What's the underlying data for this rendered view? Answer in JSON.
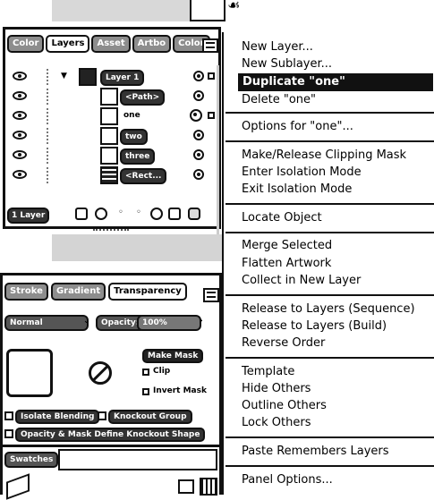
{
  "layers_panel": {
    "tabs": [
      "Color",
      "Layers",
      "Asset",
      "Artbo",
      "Color"
    ],
    "active_tab": "Layers",
    "rows": [
      {
        "name": "Layer 1",
        "indent": 0
      },
      {
        "name": "<Path>",
        "indent": 1
      },
      {
        "name": "one",
        "indent": 1
      },
      {
        "name": "two",
        "indent": 1
      },
      {
        "name": "three",
        "indent": 1
      },
      {
        "name": "<Rect...",
        "indent": 1
      }
    ],
    "layer_count": "1 Layer"
  },
  "transparency_panel": {
    "tabs": [
      "Stroke",
      "Gradient",
      "Transparency"
    ],
    "active_tab": "Transparency",
    "blend_mode": "Normal",
    "opacity_label": "Opacity:",
    "opacity_value": "100%",
    "make_mask_label": "Make Mask",
    "clip_label": "Clip",
    "invert_mask_label": "Invert Mask",
    "isolate_blending_label": "Isolate Blending",
    "knockout_group_label": "Knockout Group",
    "opacity_mask_label": "Opacity & Mask Define Knockout Shape"
  },
  "swatches_panel": {
    "tab": "Swatches"
  },
  "context_menu": {
    "groups": [
      [
        "New Layer...",
        "New Sublayer...",
        "Duplicate \"one\"",
        "Delete \"one\""
      ],
      [
        "Options for \"one\"..."
      ],
      [
        "Make/Release Clipping Mask",
        "Enter Isolation Mode",
        "Exit Isolation Mode"
      ],
      [
        "Locate Object"
      ],
      [
        "Merge Selected",
        "Flatten Artwork",
        "Collect in New Layer"
      ],
      [
        "Release to Layers (Sequence)",
        "Release to Layers (Build)",
        "Reverse Order"
      ],
      [
        "Template",
        "Hide Others",
        "Outline Others",
        "Lock Others"
      ],
      [
        "Paste Remembers Layers"
      ],
      [
        "Panel Options..."
      ]
    ],
    "highlighted": "Duplicate \"one\""
  }
}
